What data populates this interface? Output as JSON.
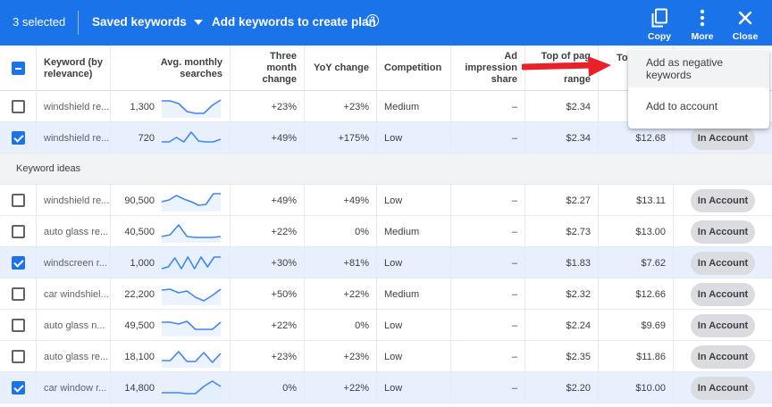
{
  "toolbar": {
    "selected_count": "3 selected",
    "saved_keywords_label": "Saved keywords",
    "add_keywords_label": "Add keywords to create plan",
    "help_glyph": "?",
    "copy_label": "Copy",
    "more_label": "More",
    "close_label": "Close"
  },
  "header": {
    "keyword": [
      "Keyword (by",
      "relevance)"
    ],
    "avg_searches": "Avg. monthly searches",
    "three_month": [
      "Three month",
      "change"
    ],
    "yoy": "YoY change",
    "competition": "Competition",
    "ad_impression": [
      "Ad impression",
      "share"
    ],
    "top_low": [
      "Top of pag",
      "",
      "range"
    ],
    "top_high": "To"
  },
  "menu": {
    "items": [
      "Add as negative keywords",
      "Add to account"
    ]
  },
  "section_label": "Keyword ideas",
  "saved_rows": [
    {
      "checked": false,
      "keyword": "windshield re...",
      "searches": "1,300",
      "trend": [
        0.85,
        0.85,
        0.7,
        0.25,
        0.15,
        0.15,
        0.6,
        0.9
      ],
      "three_month": "+23%",
      "yoy": "+23%",
      "competition": "Medium",
      "ad_share": "–",
      "top_low": "$2.34",
      "top_high": "",
      "status": ""
    },
    {
      "checked": true,
      "keyword": "windshield re...",
      "searches": "720",
      "trend": [
        0.3,
        0.3,
        0.55,
        0.3,
        0.85,
        0.35,
        0.3,
        0.3,
        0.45
      ],
      "three_month": "+49%",
      "yoy": "+175%",
      "competition": "Low",
      "ad_share": "–",
      "top_low": "$2.34",
      "top_high": "$12.68",
      "status": "In Account"
    }
  ],
  "idea_rows": [
    {
      "checked": false,
      "keyword": "windshield re...",
      "searches": "90,500",
      "trend": [
        0.45,
        0.55,
        0.8,
        0.6,
        0.45,
        0.25,
        0.3,
        0.9,
        0.9
      ],
      "three_month": "+49%",
      "yoy": "+49%",
      "competition": "Low",
      "ad_share": "–",
      "top_low": "$2.27",
      "top_high": "$13.11",
      "status": "In Account"
    },
    {
      "checked": false,
      "keyword": "auto glass re...",
      "searches": "40,500",
      "trend": [
        0.25,
        0.35,
        0.9,
        0.25,
        0.2,
        0.2,
        0.2,
        0.25
      ],
      "three_month": "+22%",
      "yoy": "0%",
      "competition": "Medium",
      "ad_share": "–",
      "top_low": "$2.73",
      "top_high": "$13.00",
      "status": "In Account"
    },
    {
      "checked": true,
      "keyword": "windscreen r...",
      "searches": "1,000",
      "trend": [
        0.2,
        0.3,
        0.8,
        0.2,
        0.85,
        0.2,
        0.85,
        0.3,
        0.85,
        0.85
      ],
      "three_month": "+30%",
      "yoy": "+81%",
      "competition": "Low",
      "ad_share": "–",
      "top_low": "$1.83",
      "top_high": "$7.62",
      "status": "In Account"
    },
    {
      "checked": false,
      "keyword": "car windshiel...",
      "searches": "22,200",
      "trend": [
        0.75,
        0.8,
        0.6,
        0.7,
        0.35,
        0.15,
        0.45,
        0.8
      ],
      "three_month": "+50%",
      "yoy": "+22%",
      "competition": "Medium",
      "ad_share": "–",
      "top_low": "$2.32",
      "top_high": "$12.66",
      "status": "In Account"
    },
    {
      "checked": false,
      "keyword": "auto glass n...",
      "searches": "49,500",
      "trend": [
        0.7,
        0.7,
        0.6,
        0.75,
        0.3,
        0.3,
        0.3,
        0.7
      ],
      "three_month": "+22%",
      "yoy": "0%",
      "competition": "Low",
      "ad_share": "–",
      "top_low": "$2.24",
      "top_high": "$9.69",
      "status": "In Account"
    },
    {
      "checked": false,
      "keyword": "auto glass re...",
      "searches": "18,100",
      "trend": [
        0.3,
        0.3,
        0.8,
        0.25,
        0.25,
        0.75,
        0.2,
        0.7
      ],
      "three_month": "+23%",
      "yoy": "+23%",
      "competition": "Low",
      "ad_share": "–",
      "top_low": "$2.35",
      "top_high": "$11.86",
      "status": "In Account"
    },
    {
      "checked": true,
      "keyword": "car window r...",
      "searches": "14,800",
      "trend": [
        0.25,
        0.25,
        0.25,
        0.2,
        0.2,
        0.6,
        0.9,
        0.6
      ],
      "three_month": "0%",
      "yoy": "+22%",
      "competition": "Low",
      "ad_share": "–",
      "top_low": "$2.20",
      "top_high": "$10.00",
      "status": "In Account"
    }
  ],
  "colors": {
    "toolbar_bg": "#1a73e8",
    "checked_row_bg": "#e8f0fe",
    "sparkline": "#4285f4",
    "sparkline_fill": "#e3eefd",
    "annotation_arrow": "#e8212b",
    "pill_bg": "#dadce0"
  }
}
